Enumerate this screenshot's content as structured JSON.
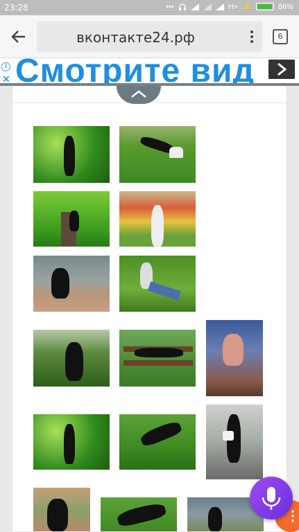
{
  "status_bar": {
    "time": "23:28",
    "network": "H+",
    "battery_percent": "86%",
    "battery_level": 0.86
  },
  "browser": {
    "url": "вконтакте24.рф",
    "tab_count": "6"
  },
  "ad": {
    "info_glyph": "i",
    "close_glyph": "✕",
    "headline": "Смотрите вид"
  },
  "icons": {
    "back": "back-arrow-icon",
    "menu": "kebab-menu-icon",
    "tabs": "tab-switcher-icon",
    "collapse": "chevron-up-icon",
    "mic": "microphone-icon"
  },
  "colors": {
    "ad_text": "#1e8fe1",
    "mic_fab": "#7b3ae8",
    "orange_fab": "#f26a2e"
  },
  "gallery": {
    "photos": [
      {
        "id": "p1",
        "scene": "girl-with-leaves"
      },
      {
        "id": "p2",
        "scene": "girl-lying-on-lawn"
      },
      {
        "id": "p3",
        "scene": "girl-in-tree"
      },
      {
        "id": "p4",
        "scene": "girl-at-flowerbed"
      },
      {
        "id": "p5",
        "scene": "girl-on-rocks-by-lake"
      },
      {
        "id": "p6",
        "scene": "girl-sitting-on-grass"
      },
      {
        "id": "p7",
        "scene": "girl-in-forest"
      },
      {
        "id": "p8",
        "scene": "girl-on-bench"
      },
      {
        "id": "p9",
        "scene": "girl-at-cafe"
      },
      {
        "id": "p10",
        "scene": "girl-with-leaves"
      },
      {
        "id": "p11",
        "scene": "girl-lying-on-grass"
      },
      {
        "id": "p12",
        "scene": "girl-with-bag"
      },
      {
        "id": "p13",
        "scene": "girl-by-tree"
      },
      {
        "id": "p14",
        "scene": "girl-reclining"
      },
      {
        "id": "p15",
        "scene": "girl-by-water"
      }
    ]
  }
}
